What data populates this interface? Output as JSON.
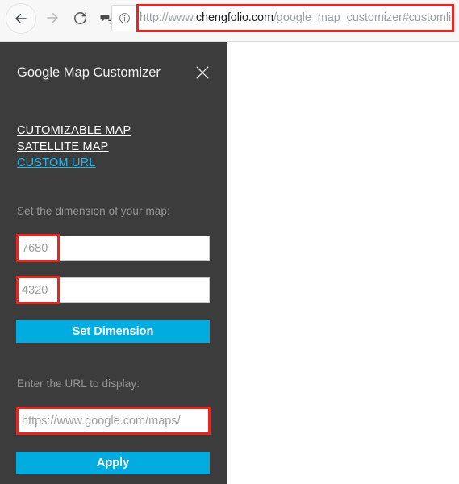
{
  "browser": {
    "back_icon": "arrow-left-icon",
    "forward_icon": "arrow-right-icon",
    "reload_icon": "reload-icon",
    "annotate_icon": "add-annotation-icon",
    "site_info_icon": "info-circle-icon",
    "url": {
      "prefix": "http://www.",
      "domain": "chengfolio.com",
      "path": "/google_map_customizer#customlink",
      "full": "http://www.chengfolio.com/google_map_customizer#customlink"
    }
  },
  "panel": {
    "title": "Google Map Customizer",
    "close_icon": "close-x-icon",
    "nav": [
      {
        "label": "CUTOMIZABLE MAP",
        "active": false
      },
      {
        "label": "SATELLITE MAP",
        "active": false
      },
      {
        "label": "CUSTOM URL",
        "active": true
      }
    ],
    "dimension_label": "Set the dimension of your map:",
    "width_placeholder": "7680",
    "height_placeholder": "4320",
    "set_dimension_label": "Set Dimension",
    "url_label": "Enter the URL to display:",
    "url_placeholder": "https://www.google.com/maps/",
    "apply_label": "Apply"
  },
  "colors": {
    "panel_background": "#3C3C3C",
    "accent_cyan": "#00ACE0",
    "active_link": "#29B6E8",
    "annotation_red": "#E8251E",
    "label_gray": "#979797",
    "toolbar_background": "#F7F7F7"
  }
}
